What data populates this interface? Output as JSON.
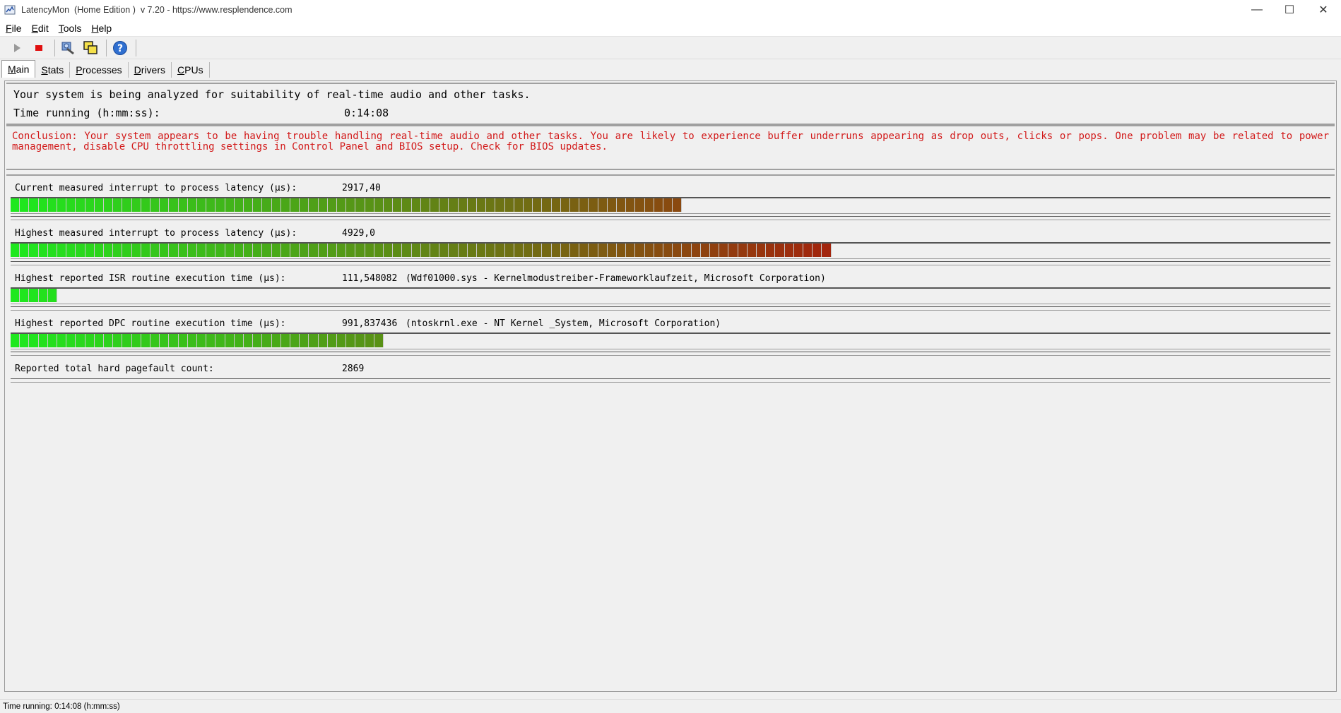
{
  "window": {
    "title": "LatencyMon  (Home Edition )  v 7.20 - https://www.resplendence.com",
    "minimize_glyph": "—",
    "maximize_glyph": "☐",
    "close_glyph": "✕"
  },
  "menu": {
    "items": [
      {
        "accel": "F",
        "rest": "ile"
      },
      {
        "accel": "E",
        "rest": "dit"
      },
      {
        "accel": "T",
        "rest": "ools"
      },
      {
        "accel": "H",
        "rest": "elp"
      }
    ]
  },
  "toolbar": {
    "buttons": [
      {
        "icon": "play-icon"
      },
      {
        "icon": "stop-icon"
      },
      {
        "icon": "tools-icon"
      },
      {
        "icon": "window-icon"
      },
      {
        "icon": "help-icon"
      }
    ]
  },
  "tabs": [
    {
      "accel": "M",
      "rest": "ain",
      "active": true
    },
    {
      "accel": "S",
      "rest": "tats",
      "active": false
    },
    {
      "accel": "P",
      "rest": "rocesses",
      "active": false
    },
    {
      "accel": "D",
      "rest": "rivers",
      "active": false
    },
    {
      "accel": "C",
      "rest": "PUs",
      "active": false
    }
  ],
  "status": {
    "line1": "Your system is being analyzed for suitability of real-time audio and other tasks.",
    "time_label": "Time running (h:mm:ss):",
    "time_value": "0:14:08"
  },
  "conclusion": "Conclusion: Your system appears to be having trouble handling real-time audio and other tasks. You are likely to experience buffer underruns appearing as drop outs, clicks or pops. One problem may be related to power management, disable CPU throttling settings in Control Panel and BIOS setup. Check for BIOS updates.",
  "metrics": [
    {
      "label": "Current measured interrupt to process latency (µs):",
      "value": "2917,40",
      "extra": "",
      "bar_fraction": 0.513
    },
    {
      "label": "Highest measured interrupt to process latency (µs):",
      "value": "4929,0",
      "extra": "",
      "bar_fraction": 0.624
    },
    {
      "label": "Highest reported ISR routine execution time (µs):",
      "value": "111,548082",
      "extra": "(Wdf01000.sys - Kernelmodustreiber-Frameworklaufzeit, Microsoft Corporation)",
      "bar_fraction": 0.034
    },
    {
      "label": "Highest reported DPC routine execution time (µs):",
      "value": "991,837436",
      "extra": "(ntoskrnl.exe - NT Kernel _System, Microsoft Corporation)",
      "bar_fraction": 0.282
    },
    {
      "label": "Reported total hard pagefault count:",
      "value": "2869",
      "extra": "",
      "bar_fraction": null
    }
  ],
  "colors": {
    "conclusion_red": "#d21a1a",
    "bar_green": "#1ee81e",
    "bar_red": "#a81c0c"
  },
  "statusbar": {
    "text": "Time running: 0:14:08  (h:mm:ss)"
  }
}
